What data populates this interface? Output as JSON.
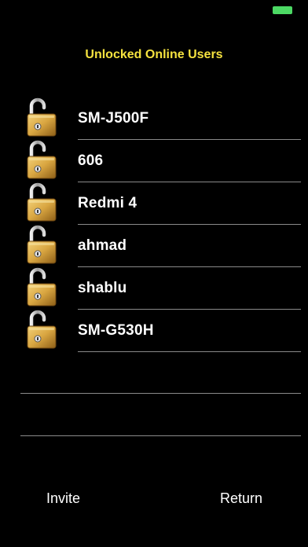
{
  "header": {
    "title": "Unlocked Online Users"
  },
  "users": [
    {
      "name": "SM-J500F",
      "icon": "unlocked-padlock-icon"
    },
    {
      "name": "606",
      "icon": "unlocked-padlock-icon"
    },
    {
      "name": "Redmi 4",
      "icon": "unlocked-padlock-icon"
    },
    {
      "name": "ahmad",
      "icon": "unlocked-padlock-icon"
    },
    {
      "name": "shablu",
      "icon": "unlocked-padlock-icon"
    },
    {
      "name": "SM-G530H",
      "icon": "unlocked-padlock-icon"
    }
  ],
  "footer": {
    "invite_label": "Invite",
    "return_label": "Return"
  },
  "colors": {
    "background": "#000000",
    "title": "#f5e23f",
    "battery": "#4cd964",
    "separator": "#8a8a8a",
    "lock_gold": "#d9a641"
  }
}
